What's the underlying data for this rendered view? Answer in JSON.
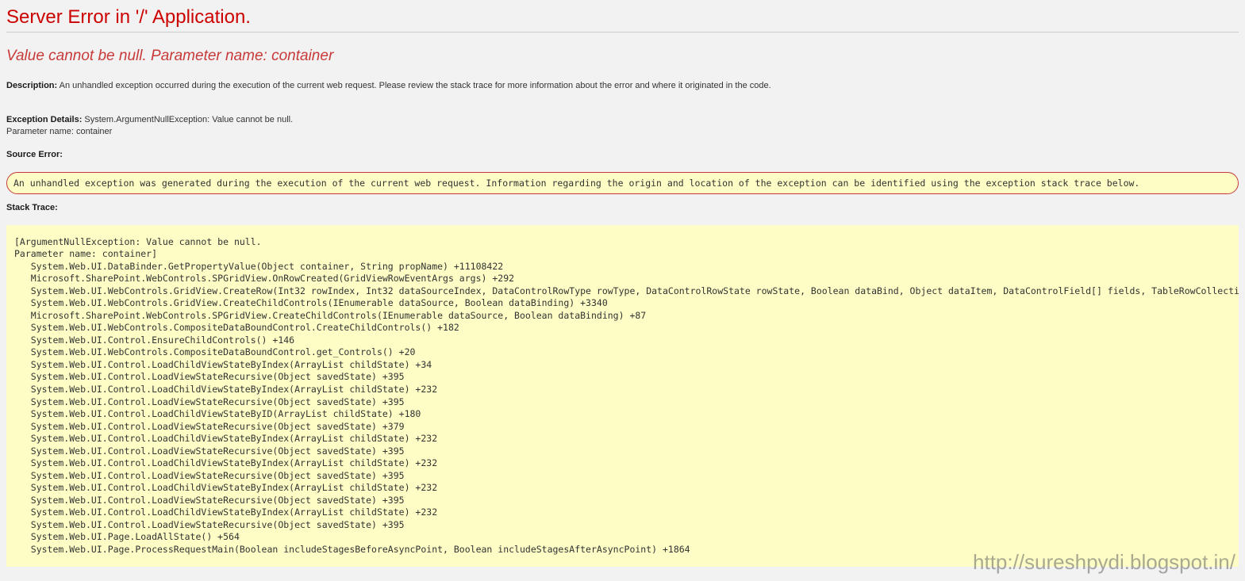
{
  "title": "Server Error in '/' Application.",
  "subheading": "Value cannot be null.\nParameter name: container",
  "description_label": "Description:",
  "description_text": " An unhandled exception occurred during the execution of the current web request. Please review the stack trace for more information about the error and where it originated in the code.",
  "exception_details_label": "Exception Details:",
  "exception_details_text": " System.ArgumentNullException: Value cannot be null.\nParameter name: container",
  "source_error_label": "Source Error:",
  "source_error_text": "An unhandled exception was generated during the execution of the current web request. Information regarding the origin and location of the exception can be identified using the exception stack trace below.",
  "stack_trace_label": "Stack Trace:",
  "stack_trace_text": "[ArgumentNullException: Value cannot be null.\nParameter name: container]\n   System.Web.UI.DataBinder.GetPropertyValue(Object container, String propName) +11108422\n   Microsoft.SharePoint.WebControls.SPGridView.OnRowCreated(GridViewRowEventArgs args) +292\n   System.Web.UI.WebControls.GridView.CreateRow(Int32 rowIndex, Int32 dataSourceIndex, DataControlRowType rowType, DataControlRowState rowState, Boolean dataBind, Object dataItem, DataControlField[] fields, TableRowCollection rows, PagedDataSource pagedDataSource)\n   System.Web.UI.WebControls.GridView.CreateChildControls(IEnumerable dataSource, Boolean dataBinding) +3340\n   Microsoft.SharePoint.WebControls.SPGridView.CreateChildControls(IEnumerable dataSource, Boolean dataBinding) +87\n   System.Web.UI.WebControls.CompositeDataBoundControl.CreateChildControls() +182\n   System.Web.UI.Control.EnsureChildControls() +146\n   System.Web.UI.WebControls.CompositeDataBoundControl.get_Controls() +20\n   System.Web.UI.Control.LoadChildViewStateByIndex(ArrayList childState) +34\n   System.Web.UI.Control.LoadViewStateRecursive(Object savedState) +395\n   System.Web.UI.Control.LoadChildViewStateByIndex(ArrayList childState) +232\n   System.Web.UI.Control.LoadViewStateRecursive(Object savedState) +395\n   System.Web.UI.Control.LoadChildViewStateByID(ArrayList childState) +180\n   System.Web.UI.Control.LoadViewStateRecursive(Object savedState) +379\n   System.Web.UI.Control.LoadChildViewStateByIndex(ArrayList childState) +232\n   System.Web.UI.Control.LoadViewStateRecursive(Object savedState) +395\n   System.Web.UI.Control.LoadChildViewStateByIndex(ArrayList childState) +232\n   System.Web.UI.Control.LoadViewStateRecursive(Object savedState) +395\n   System.Web.UI.Control.LoadChildViewStateByIndex(ArrayList childState) +232\n   System.Web.UI.Control.LoadViewStateRecursive(Object savedState) +395\n   System.Web.UI.Control.LoadChildViewStateByIndex(ArrayList childState) +232\n   System.Web.UI.Control.LoadViewStateRecursive(Object savedState) +395\n   System.Web.UI.Page.LoadAllState() +564\n   System.Web.UI.Page.ProcessRequestMain(Boolean includeStagesBeforeAsyncPoint, Boolean includeStagesAfterAsyncPoint) +1864",
  "watermark": "http://sureshpydi.blogspot.in/"
}
